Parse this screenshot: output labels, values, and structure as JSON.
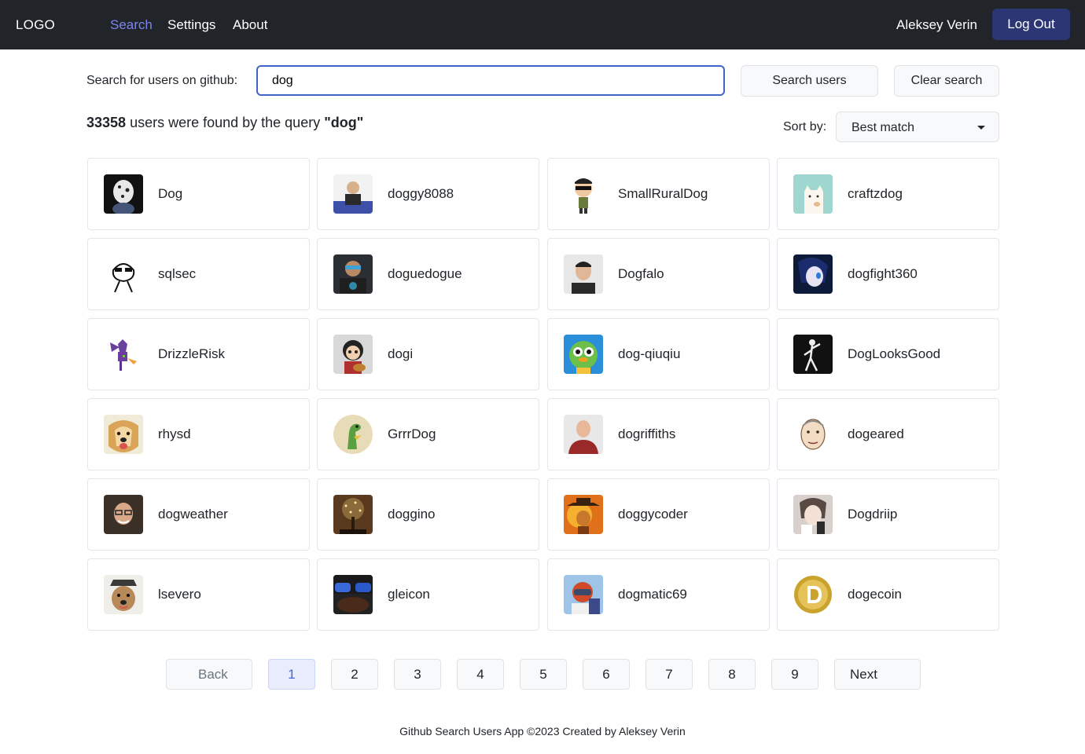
{
  "header": {
    "logo": "LOGO",
    "nav": [
      {
        "label": "Search",
        "active": true
      },
      {
        "label": "Settings",
        "active": false
      },
      {
        "label": "About",
        "active": false
      }
    ],
    "user_name": "Aleksey Verin",
    "logout_label": "Log Out"
  },
  "search": {
    "label": "Search for users on github:",
    "value": "dog",
    "search_button": "Search users",
    "clear_button": "Clear search"
  },
  "results": {
    "count": "33358",
    "text_middle": " users were found by the query ",
    "query_quoted": "\"dog\"",
    "sort_label": "Sort by:",
    "sort_value": "Best match"
  },
  "users": [
    {
      "login": "Dog",
      "avatar": "dalmatian-avatar-icon"
    },
    {
      "login": "doggy8088",
      "avatar": "man-presenting-avatar-icon"
    },
    {
      "login": "SmallRuralDog",
      "avatar": "cartoon-sunglasses-avatar-icon"
    },
    {
      "login": "craftzdog",
      "avatar": "white-cat-avatar-icon"
    },
    {
      "login": "sqlsec",
      "avatar": "meme-sunglasses-avatar-icon"
    },
    {
      "login": "doguedogue",
      "avatar": "man-sunglasses-avatar-icon"
    },
    {
      "login": "Dogfalo",
      "avatar": "man-portrait-avatar-icon"
    },
    {
      "login": "dogfight360",
      "avatar": "anime-face-avatar-icon"
    },
    {
      "login": "DrizzleRisk",
      "avatar": "purple-robot-avatar-icon"
    },
    {
      "login": "dogi",
      "avatar": "cartoon-guitar-avatar-icon"
    },
    {
      "login": "dog-qiuqiu",
      "avatar": "green-frog-avatar-icon"
    },
    {
      "login": "DogLooksGood",
      "avatar": "dancer-silhouette-avatar-icon"
    },
    {
      "login": "rhysd",
      "avatar": "golden-dog-avatar-icon"
    },
    {
      "login": "GrrrDog",
      "avatar": "green-dinosaur-avatar-icon"
    },
    {
      "login": "dogriffiths",
      "avatar": "man-red-sweater-avatar-icon"
    },
    {
      "login": "dogeared",
      "avatar": "sketch-face-avatar-icon"
    },
    {
      "login": "dogweather",
      "avatar": "man-glasses-avatar-icon"
    },
    {
      "login": "doggino",
      "avatar": "glowing-tree-avatar-icon"
    },
    {
      "login": "doggycoder",
      "avatar": "cat-in-hat-avatar-icon"
    },
    {
      "login": "Dogdriip",
      "avatar": "anime-girl-avatar-icon"
    },
    {
      "login": "lsevero",
      "avatar": "dog-with-hat-avatar-icon"
    },
    {
      "login": "gleicon",
      "avatar": "sunglasses-closeup-avatar-icon"
    },
    {
      "login": "dogmatic69",
      "avatar": "pilot-avatar-icon"
    },
    {
      "login": "dogecoin",
      "avatar": "dogecoin-logo-avatar-icon"
    }
  ],
  "pagination": {
    "back_label": "Back",
    "next_label": "Next",
    "pages": [
      "1",
      "2",
      "3",
      "4",
      "5",
      "6",
      "7",
      "8",
      "9"
    ],
    "current": "1"
  },
  "footer": "Github Search Users App ©2023 Created by Aleksey Verin"
}
